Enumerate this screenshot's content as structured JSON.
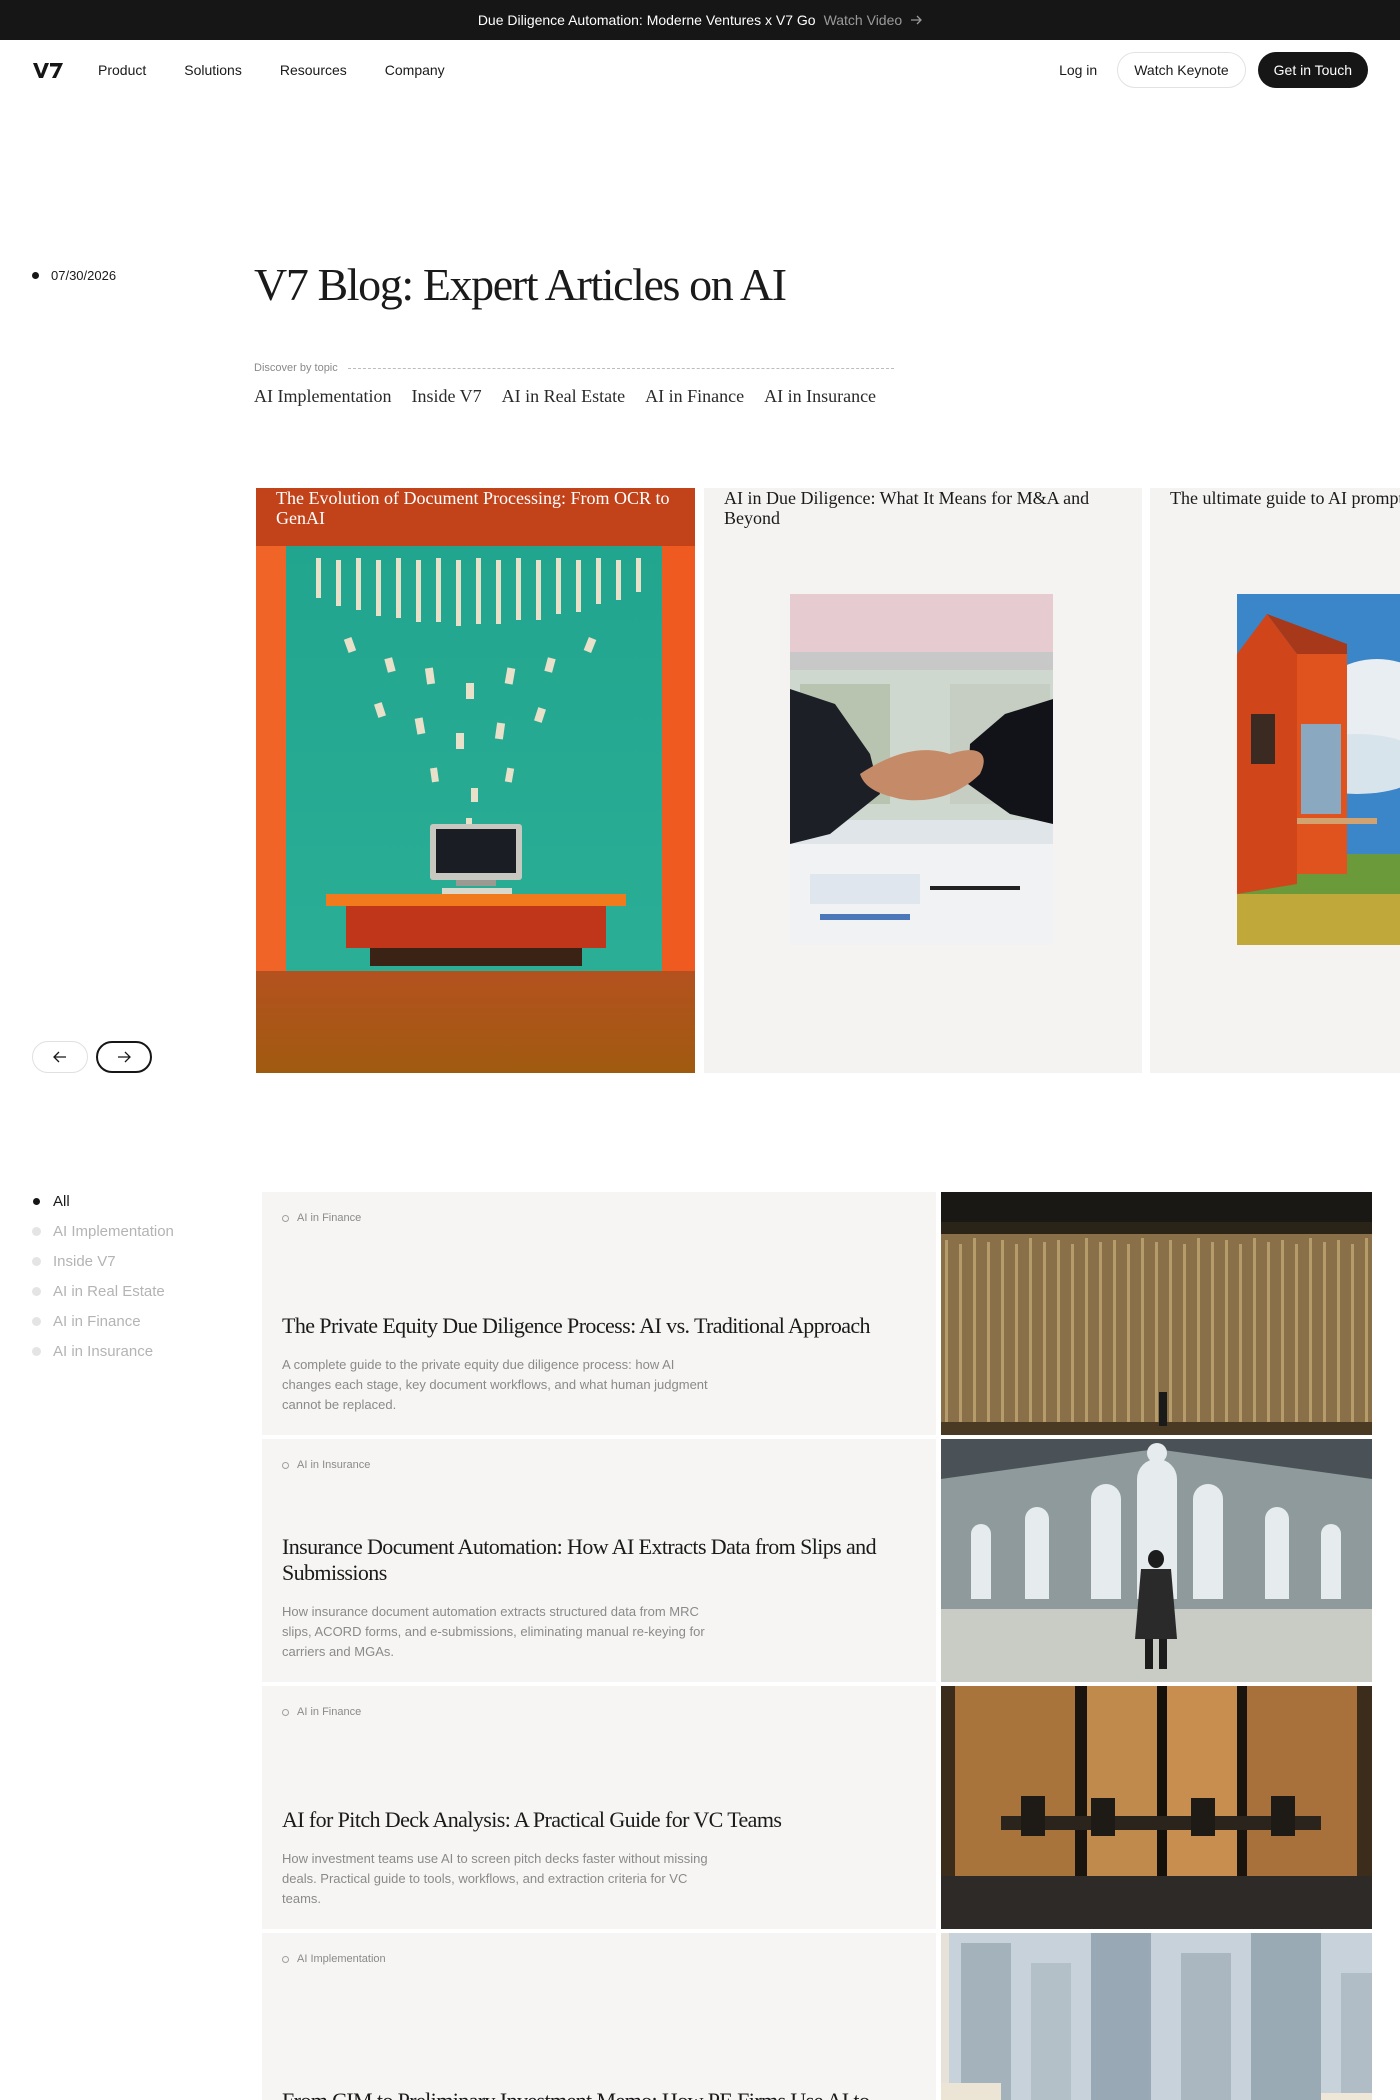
{
  "announcement": {
    "text": "Due Diligence Automation: Moderne Ventures x V7 Go",
    "link": "Watch Video"
  },
  "nav": {
    "logo": "V7",
    "links": [
      "Product",
      "Solutions",
      "Resources",
      "Company"
    ],
    "login": "Log in",
    "keynote": "Watch Keynote",
    "cta": "Get in Touch"
  },
  "hero": {
    "date": "07/30/2026",
    "title": "V7 Blog: Expert Articles on AI",
    "discover_label": "Discover by topic",
    "topics": [
      "AI Implementation",
      "Inside V7",
      "AI in Real Estate",
      "AI in Finance",
      "AI in Insurance"
    ]
  },
  "featured": [
    {
      "title": "The Evolution of Document Processing: From OCR to GenAI"
    },
    {
      "title": "AI in Due Diligence: What It Means for M&A and Beyond"
    },
    {
      "title": "The ultimate guide to AI prompting"
    }
  ],
  "filters": [
    "All",
    "AI Implementation",
    "Inside V7",
    "AI in Real Estate",
    "AI in Finance",
    "AI in Insurance"
  ],
  "articles": [
    {
      "tag": "AI in Finance",
      "title": "The Private Equity Due Diligence Process: AI vs. Traditional Approach",
      "desc": "A complete guide to the private equity due diligence process: how AI changes each stage, key document workflows, and what human judgment cannot be replaced."
    },
    {
      "tag": "AI in Insurance",
      "title": "Insurance Document Automation: How AI Extracts Data from Slips and Submissions",
      "desc": "How insurance document automation extracts structured data from MRC slips, ACORD forms, and e-submissions, eliminating manual re-keying for carriers and MGAs."
    },
    {
      "tag": "AI in Finance",
      "title": "AI for Pitch Deck Analysis: A Practical Guide for VC Teams",
      "desc": "How investment teams use AI to screen pitch decks faster without missing deals. Practical guide to tools, workflows, and extraction criteria for VC teams."
    },
    {
      "tag": "AI Implementation",
      "title": "From CIM to Preliminary Investment Memo: How PE Firms Use AI to Accelerate Deal Screening",
      "desc": ""
    }
  ]
}
